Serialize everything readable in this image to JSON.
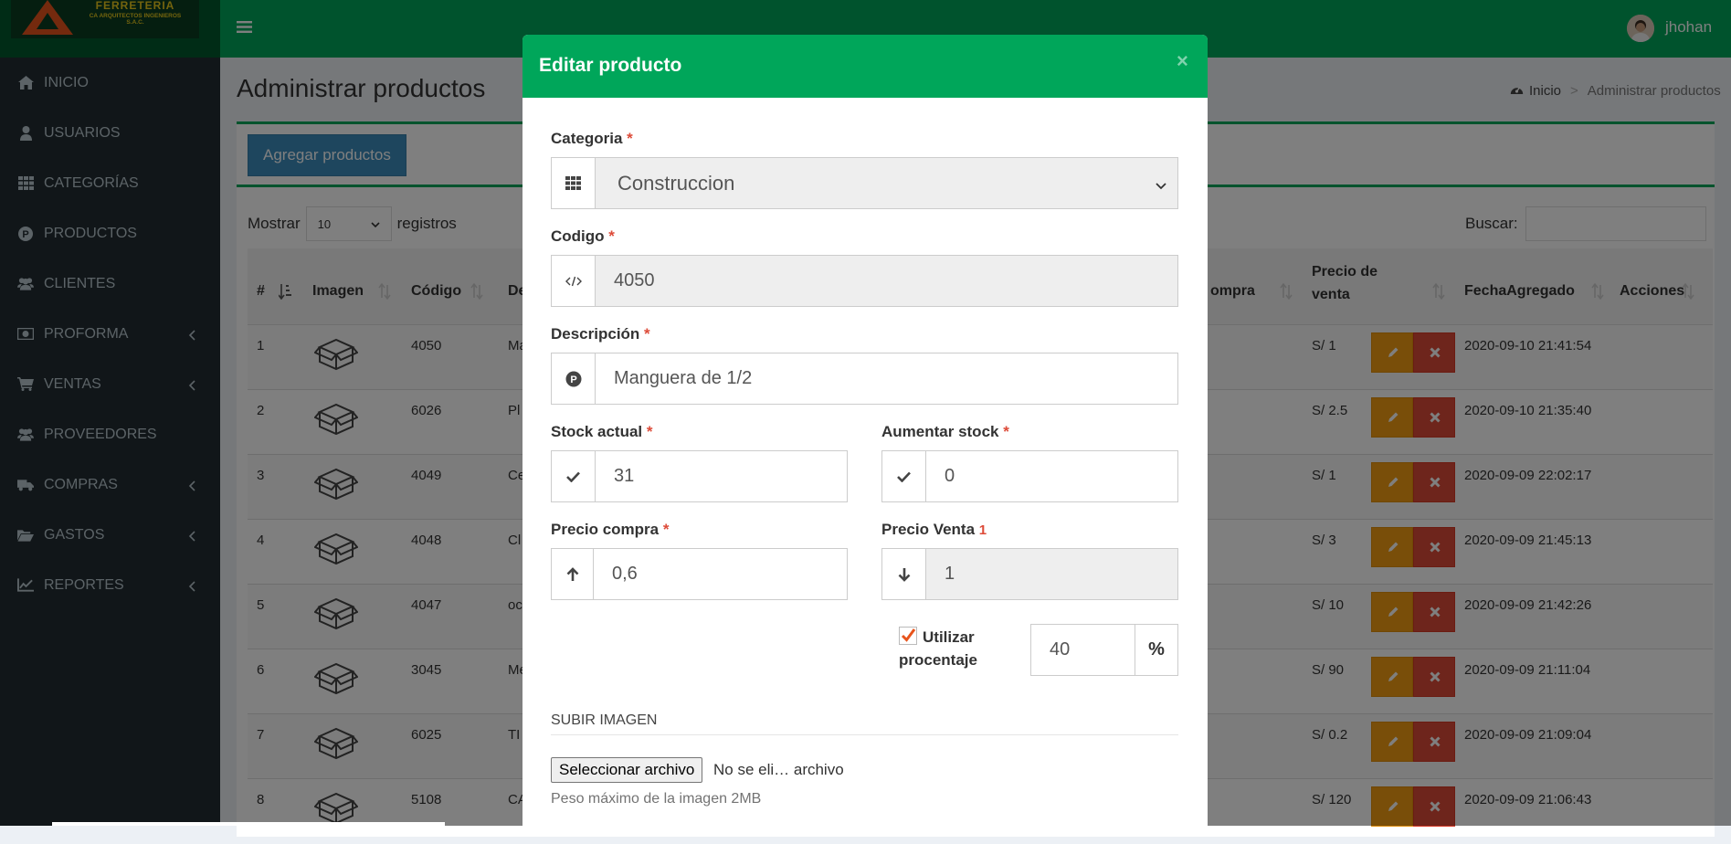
{
  "brand": {
    "line1": "FERRETERIA",
    "line2": "CA ARQUITECTOS INGENIEROS S.A.C."
  },
  "header": {
    "username": "jhohan"
  },
  "sidebar": {
    "items": [
      {
        "label": "INICIO",
        "icon": "home-icon",
        "has_submenu": false
      },
      {
        "label": "USUARIOS",
        "icon": "user-icon",
        "has_submenu": false
      },
      {
        "label": "CATEGORÍAS",
        "icon": "th-icon",
        "has_submenu": false
      },
      {
        "label": "PRODUCTOS",
        "icon": "product-hunt-icon",
        "has_submenu": false
      },
      {
        "label": "CLIENTES",
        "icon": "users-icon",
        "has_submenu": false
      },
      {
        "label": "PROFORMA",
        "icon": "money-icon",
        "has_submenu": true
      },
      {
        "label": "VENTAS",
        "icon": "cart-icon",
        "has_submenu": true
      },
      {
        "label": "PROVEEDORES",
        "icon": "users-icon",
        "has_submenu": false
      },
      {
        "label": "COMPRAS",
        "icon": "truck-icon",
        "has_submenu": true
      },
      {
        "label": "GASTOS",
        "icon": "folder-open-icon",
        "has_submenu": true
      },
      {
        "label": "REPORTES",
        "icon": "line-chart-icon",
        "has_submenu": true
      }
    ]
  },
  "page": {
    "title": "Administrar productos",
    "breadcrumb_home": "Inicio",
    "breadcrumb_current": "Administrar productos",
    "add_button": "Agregar productos",
    "show_label": "Mostrar",
    "show_value": "10",
    "records_label": "registros",
    "search_label": "Buscar:"
  },
  "table": {
    "headers": {
      "num": "#",
      "image": "Imagen",
      "code": "Código",
      "desc": "De",
      "buy": "ompra",
      "sell_line1": "Precio de",
      "sell_line2": "venta",
      "date": "FechaAgregado",
      "actions": "Acciones"
    },
    "rows": [
      {
        "num": "1",
        "code": "4050",
        "desc": "Ma",
        "sell": "S/ 1",
        "date": "2020-09-10 21:41:54"
      },
      {
        "num": "2",
        "code": "6026",
        "desc": "Pl",
        "sell": "S/ 2.5",
        "date": "2020-09-10 21:35:40"
      },
      {
        "num": "3",
        "code": "4049",
        "desc": "Ce",
        "sell": "S/ 1",
        "date": "2020-09-09 22:02:17"
      },
      {
        "num": "4",
        "code": "4048",
        "desc": "Cl",
        "sell": "S/ 3",
        "date": "2020-09-09 21:45:13"
      },
      {
        "num": "5",
        "code": "4047",
        "desc": "oc",
        "sell": "S/ 10",
        "date": "2020-09-09 21:42:26"
      },
      {
        "num": "6",
        "code": "3045",
        "desc": "Me",
        "sell": "S/ 90",
        "date": "2020-09-09 21:11:04"
      },
      {
        "num": "7",
        "code": "6025",
        "desc": "TI",
        "sell": "S/ 0.2",
        "date": "2020-09-09 21:09:04"
      },
      {
        "num": "8",
        "code": "5108",
        "desc": "CA",
        "sell": "S/ 120",
        "date": "2020-09-09 21:06:43"
      }
    ]
  },
  "modal": {
    "title": "Editar producto",
    "close": "×",
    "required_mark": "*",
    "categoria_label": "Categoria",
    "categoria_value": "Construccion",
    "codigo_label": "Codigo",
    "codigo_value": "4050",
    "descripcion_label": "Descripción",
    "descripcion_value": "Manguera de 1/2",
    "stock_label": "Stock actual",
    "stock_value": "31",
    "aumentar_label": "Aumentar stock",
    "aumentar_value": "0",
    "precio_compra_label": "Precio compra",
    "precio_compra_value": "0,6",
    "precio_venta_label": "Precio Venta",
    "precio_venta_mark": "1",
    "precio_venta_value": "1",
    "utilizar_label": "Utilizar procentaje",
    "utilizar_checked": true,
    "porcentaje_value": "40",
    "porcentaje_symbol": "%",
    "subir_label": "SUBIR IMAGEN",
    "file_button": "Seleccionar archivo",
    "file_status": "No se eli… archivo",
    "help_text": "Peso máximo de la imagen 2MB"
  },
  "colors": {
    "header_green": "#00a65a",
    "sidebar_bg": "#222d32",
    "primary_blue": "#3c8dbc",
    "warning": "#f39c12",
    "danger": "#dd4b39"
  }
}
